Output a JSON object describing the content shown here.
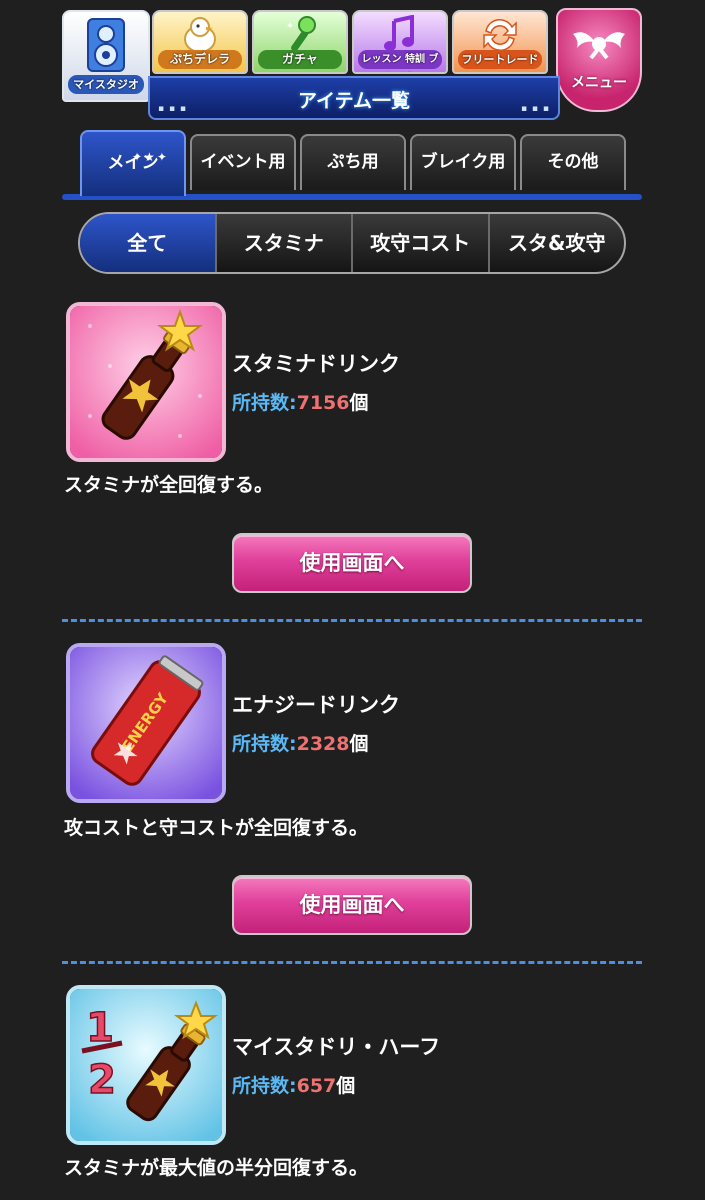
{
  "nav": {
    "studio_label": "マイスタジオ",
    "petit_label": "ぷちデレラ",
    "gacha_label": "ガチャ",
    "lesson_label": "レッスン 特訓 ブレイク",
    "trade_label": "フリートレード",
    "menu_label": "メニュー"
  },
  "page_title": "アイテム一覧",
  "tabs": [
    {
      "label": "メイン",
      "active": true
    },
    {
      "label": "イベント用",
      "active": false
    },
    {
      "label": "ぷち用",
      "active": false
    },
    {
      "label": "ブレイク用",
      "active": false
    },
    {
      "label": "その他",
      "active": false
    }
  ],
  "filters": [
    {
      "label": "全て",
      "active": true
    },
    {
      "label": "スタミナ",
      "active": false
    },
    {
      "label": "攻守コスト",
      "active": false
    },
    {
      "label": "スタ&攻守",
      "active": false
    }
  ],
  "qty_prefix": "所持数:",
  "qty_suffix": "個",
  "use_button_label": "使用画面へ",
  "items": [
    {
      "name": "スタミナドリンク",
      "quantity": "7156",
      "description": "スタミナが全回復する。",
      "icon": "stamina-drink-icon",
      "frame_color": "#f070b0"
    },
    {
      "name": "エナジードリンク",
      "quantity": "2328",
      "description": "攻コストと守コストが全回復する。",
      "icon": "energy-drink-icon",
      "frame_color": "#8a6ae8"
    },
    {
      "name": "マイスタドリ・ハーフ",
      "quantity": "657",
      "description": "スタミナが最大値の半分回復する。",
      "icon": "half-stamina-drink-icon",
      "frame_color": "#6cc6ea"
    }
  ],
  "icon_text": {
    "energy_label": "ENERGY",
    "half_fraction_top": "1",
    "half_fraction_bottom": "2"
  },
  "colors": {
    "accent_blue": "#2450c8",
    "use_button": "#e0409a",
    "qty_key": "#5bb8f3",
    "qty_value": "#ee7272"
  }
}
